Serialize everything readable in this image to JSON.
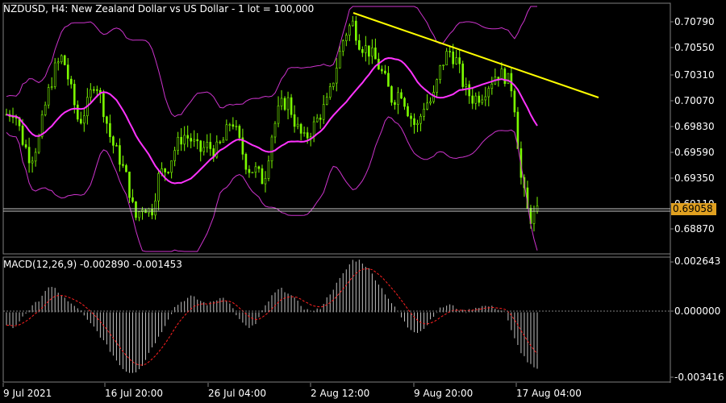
{
  "header": {
    "symbol": "NZDUSD",
    "timeframe": "H4",
    "description": "New Zealand Dollar vs US Dollar - 1 lot = 100,000",
    "title_text": "NZDUSD, H4:  New Zealand Dollar vs US Dollar - 1 lot = 100,000"
  },
  "macd": {
    "label": "MACD(12,26,9) -0.002890 -0.001453",
    "params": "12,26,9",
    "main_value": "-0.002890",
    "signal_value": "-0.001453",
    "scale": [
      "0.002643",
      "0.000000",
      "-0.003416"
    ]
  },
  "price_scale": [
    "0.70790",
    "0.70550",
    "0.70310",
    "0.70070",
    "0.69830",
    "0.69590",
    "0.69350",
    "0.69110",
    "0.68870"
  ],
  "current_price": "0.69058",
  "time_axis": [
    "9 Jul 2021",
    "16 Jul 20:00",
    "26 Jul 04:00",
    "2 Aug 12:00",
    "9 Aug 20:00",
    "17 Aug 04:00"
  ],
  "colors": {
    "background": "#000000",
    "candles": "#7cfc00",
    "bollinger_bands": "#cc33cc",
    "moving_average": "#ff33ff",
    "trendline": "#ffff00",
    "macd_histogram": "#c0c0c0",
    "macd_signal": "#ff2020",
    "price_badge": "#e0a020",
    "grid": "#808080"
  },
  "chart_data": {
    "type": "candlestick",
    "symbol": "NZDUSD",
    "timeframe": "H4",
    "ylim": [
      0.6876,
      0.7094
    ],
    "current_price": 0.69058,
    "indicators": [
      "Bollinger Bands",
      "Moving Average",
      "MACD(12,26,9)"
    ],
    "macd_ylim": [
      -0.003416,
      0.002643
    ],
    "price_close_path": [
      0.6998,
      0.7002,
      0.6975,
      0.6958,
      0.6975,
      0.7012,
      0.7038,
      0.705,
      0.702,
      0.699,
      0.7005,
      0.703,
      0.7005,
      0.6975,
      0.696,
      0.694,
      0.6905,
      0.6918,
      0.691,
      0.6945,
      0.695,
      0.6968,
      0.698,
      0.6975,
      0.6965,
      0.697,
      0.6965,
      0.6975,
      0.6995,
      0.6972,
      0.695,
      0.6948,
      0.6938,
      0.698,
      0.7005,
      0.701,
      0.6988,
      0.6975,
      0.6985,
      0.6998,
      0.701,
      0.704,
      0.7068,
      0.708,
      0.706,
      0.7055,
      0.7045,
      0.703,
      0.701,
      0.702,
      0.7,
      0.6985,
      0.7008,
      0.701,
      0.704,
      0.7055,
      0.7045,
      0.702,
      0.7012,
      0.7015,
      0.7025,
      0.7035,
      0.7032,
      0.702,
      0.694,
      0.6905,
      0.691
    ],
    "macd_histogram_path": [
      -0.0006,
      -0.0008,
      -0.0002,
      0.0002,
      0.0006,
      0.0012,
      0.0012,
      0.0008,
      0.0004,
      0.0002,
      -0.0004,
      -0.0008,
      -0.0014,
      -0.002,
      -0.0026,
      -0.003,
      -0.003,
      -0.0026,
      -0.0018,
      -0.0012,
      -0.0004,
      0.0003,
      0.0006,
      0.0008,
      0.0006,
      0.0004,
      0.0006,
      0.0008,
      0.0003,
      -0.0004,
      -0.0008,
      -0.0006,
      0.0002,
      0.0008,
      0.0012,
      0.001,
      0.0006,
      0.0002,
      0.0,
      0.0002,
      0.0008,
      0.0014,
      0.002,
      0.0026,
      0.0026,
      0.0022,
      0.0016,
      0.001,
      0.0004,
      -0.0002,
      -0.0008,
      -0.001,
      -0.0008,
      -0.0002,
      0.0002,
      0.0004,
      0.0002,
      0.0,
      0.0002,
      0.0003,
      0.0003,
      0.0002,
      0.0,
      -0.0012,
      -0.002,
      -0.0026,
      -0.0029
    ]
  }
}
